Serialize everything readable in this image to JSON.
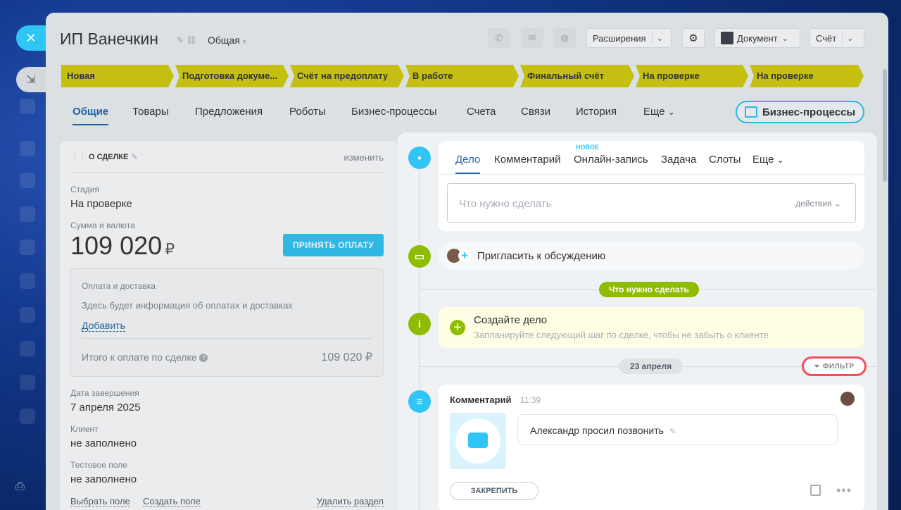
{
  "deal": {
    "title": "ИП Ванечкин",
    "category": "Общая"
  },
  "toolbar": {
    "extensions_label": "Расширения",
    "document_label": "Документ",
    "invoice_label": "Счёт"
  },
  "stages": [
    "Новая",
    "Подготовка докуме...",
    "Счёт на предоплату",
    "В работе",
    "Финальный счёт",
    "На проверке",
    "На проверке"
  ],
  "tabs": {
    "items": [
      "Общие",
      "Товары",
      "Предложения",
      "Роботы",
      "Бизнес-процессы",
      "Счета",
      "Связи",
      "История",
      "Еще"
    ],
    "bp_button": "Бизнес-процессы"
  },
  "card": {
    "header": "О СДЕЛКЕ",
    "edit_link": "изменить",
    "stage_label": "Стадия",
    "stage_value": "На проверке",
    "sum_label": "Сумма и валюта",
    "sum_value": "109 020",
    "currency": "₽",
    "pay_button": "ПРИНЯТЬ ОПЛАТУ",
    "payment": {
      "title": "Оплата и доставка",
      "info": "Здесь будет информация об оплатах и доставках",
      "add_link": "Добавить",
      "total_label": "Итого к оплате по сделке",
      "total_value": "109 020 ₽"
    },
    "close_date_label": "Дата завершения",
    "close_date_value": "7 апреля 2025",
    "client_label": "Клиент",
    "client_value": "не заполнено",
    "test_label": "Тестовое поле",
    "test_value": "не заполнено",
    "links": [
      "Выбрать поле",
      "Создать поле",
      "Удалить раздел"
    ]
  },
  "timeline": {
    "editor_tabs": [
      "Дело",
      "Комментарий",
      "Онлайн-запись",
      "Задача",
      "Слоты",
      "Еще"
    ],
    "new_badge": "НОВОЕ",
    "input_placeholder": "Что нужно сделать",
    "actions_label": "действия",
    "invite_text": "Пригласить к обсуждению",
    "todo_pill": "Что нужно сделать",
    "todo_title": "Создайте дело",
    "todo_subtitle": "Запланируйте следующий шаг по сделке, чтобы не забыть о клиенте",
    "date_pill": "23 апреля",
    "filter_label": "ФИЛЬТР",
    "comment_header": "Комментарий",
    "comment_time": "11:39",
    "comment_text": "Александр просил позвонить",
    "pin_button": "ЗАКРЕПИТЬ"
  },
  "colors": {
    "stage_yellow": "#d5cd0b",
    "accent_blue": "#2fc6f6",
    "link_blue": "#2066b0",
    "green": "#8fbc00",
    "filter_highlight": "#f0505a"
  }
}
